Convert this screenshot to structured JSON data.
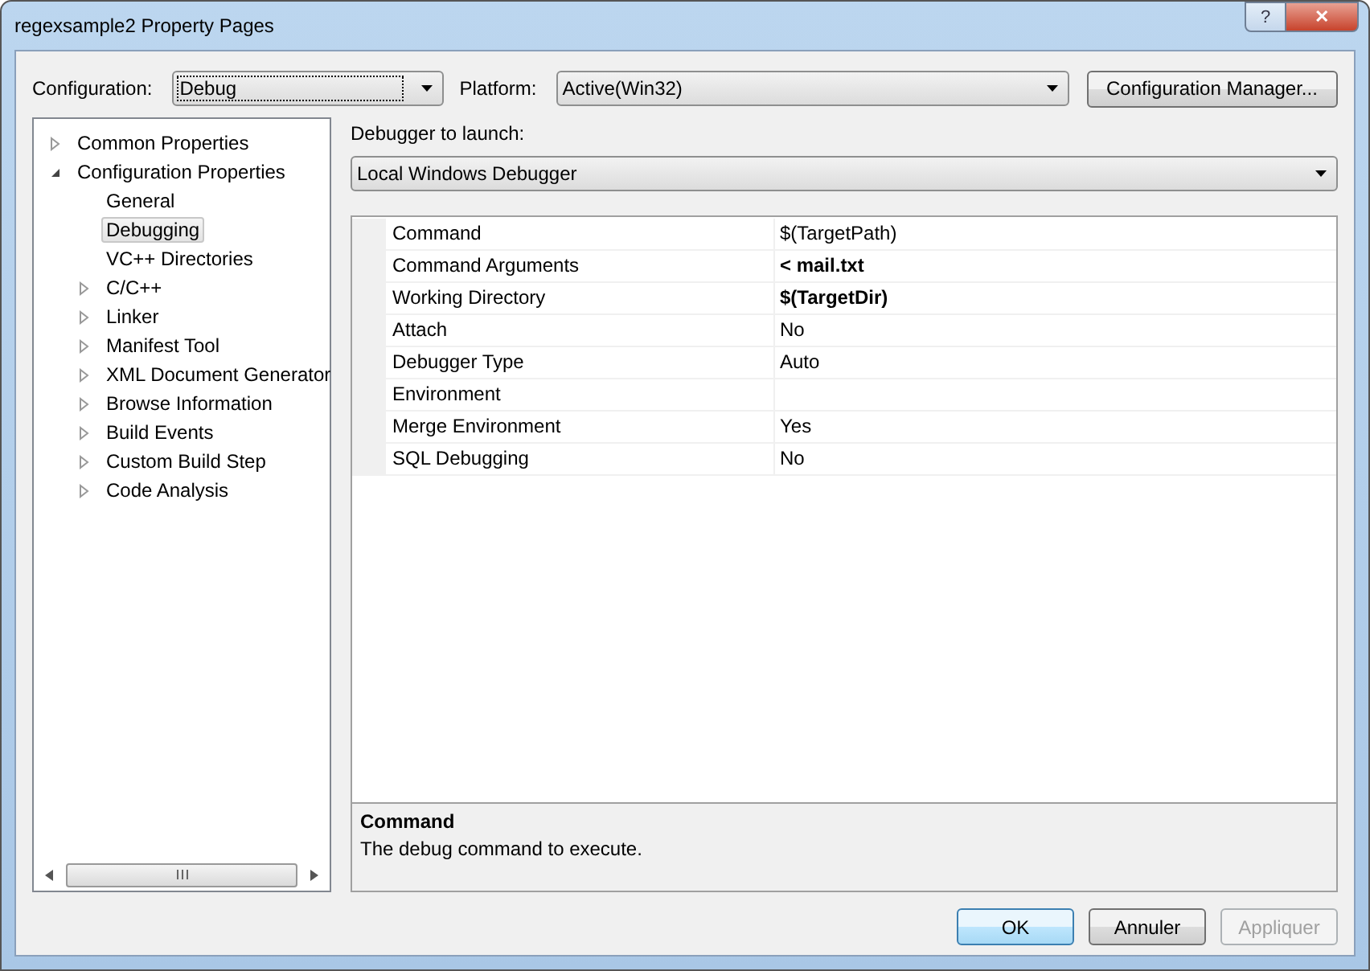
{
  "window": {
    "title": "regexsample2 Property Pages",
    "help": "?",
    "close": "✕"
  },
  "configuration": {
    "label": "Configuration:",
    "value": "Debug"
  },
  "platform": {
    "label": "Platform:",
    "value": "Active(Win32)"
  },
  "config_manager_button": "Configuration Manager...",
  "tree": [
    {
      "label": "Common Properties",
      "kind": "group",
      "expanded": false,
      "selected": false
    },
    {
      "label": "Configuration Properties",
      "kind": "group",
      "expanded": true,
      "selected": false,
      "children": [
        {
          "label": "General",
          "kind": "page",
          "selected": false
        },
        {
          "label": "Debugging",
          "kind": "page",
          "selected": true
        },
        {
          "label": "VC++ Directories",
          "kind": "page",
          "selected": false
        },
        {
          "label": "C/C++",
          "kind": "group",
          "expanded": false,
          "selected": false
        },
        {
          "label": "Linker",
          "kind": "group",
          "expanded": false,
          "selected": false
        },
        {
          "label": "Manifest Tool",
          "kind": "group",
          "expanded": false,
          "selected": false
        },
        {
          "label": "XML Document Generator",
          "kind": "group",
          "expanded": false,
          "selected": false
        },
        {
          "label": "Browse Information",
          "kind": "group",
          "expanded": false,
          "selected": false
        },
        {
          "label": "Build Events",
          "kind": "group",
          "expanded": false,
          "selected": false
        },
        {
          "label": "Custom Build Step",
          "kind": "group",
          "expanded": false,
          "selected": false
        },
        {
          "label": "Code Analysis",
          "kind": "group",
          "expanded": false,
          "selected": false
        }
      ]
    }
  ],
  "debugger": {
    "label": "Debugger to launch:",
    "value": "Local Windows Debugger"
  },
  "properties": [
    {
      "name": "Command",
      "value": "$(TargetPath)",
      "modified": false
    },
    {
      "name": "Command Arguments",
      "value": "< mail.txt",
      "modified": true
    },
    {
      "name": "Working Directory",
      "value": "$(TargetDir)",
      "modified": true
    },
    {
      "name": "Attach",
      "value": "No",
      "modified": false
    },
    {
      "name": "Debugger Type",
      "value": "Auto",
      "modified": false
    },
    {
      "name": "Environment"
    },
    {
      "name": "Merge Environment",
      "value": "Yes",
      "modified": false
    },
    {
      "name": "SQL Debugging",
      "value": "No",
      "modified": false
    }
  ],
  "description": {
    "title": "Command",
    "text": "The debug command to execute."
  },
  "buttons": [
    {
      "label": "OK",
      "default": true,
      "disabled": false
    },
    {
      "label": "Annuler",
      "default": false,
      "disabled": false
    },
    {
      "label": "Appliquer",
      "default": false,
      "disabled": true
    }
  ]
}
